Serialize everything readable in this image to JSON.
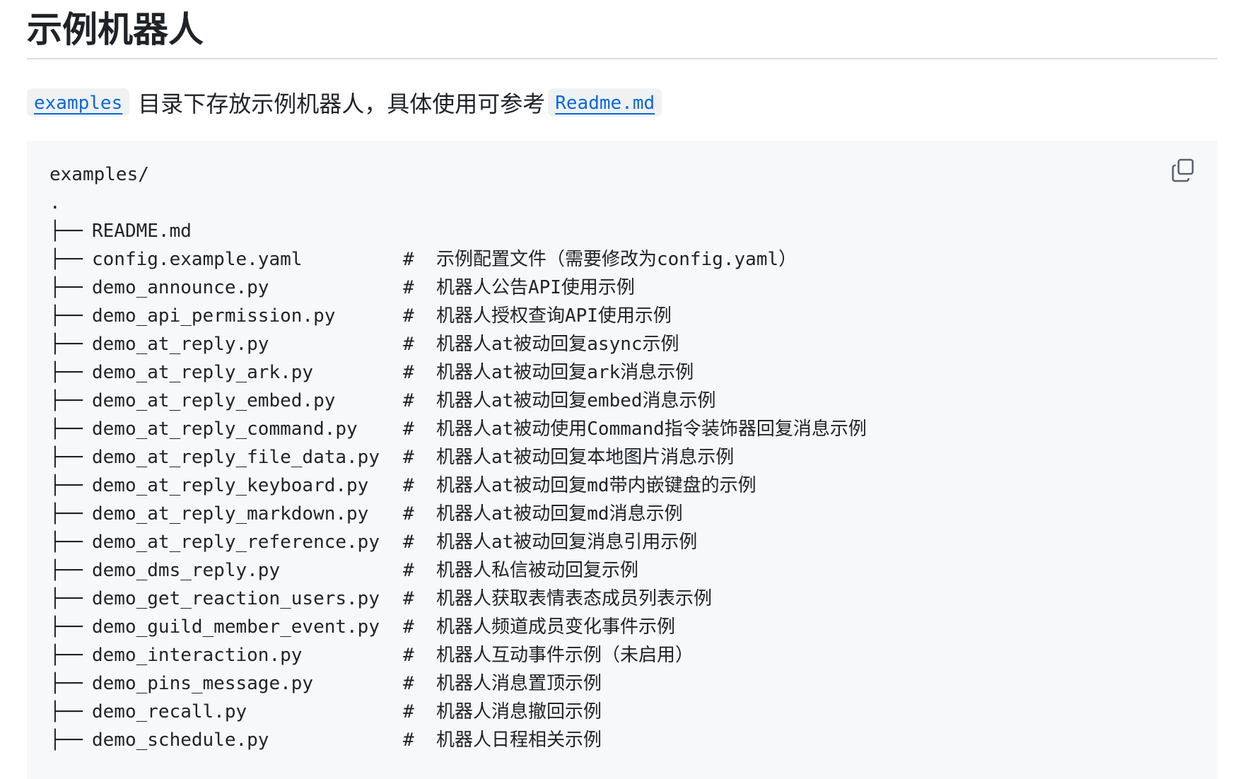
{
  "heading": "示例机器人",
  "intro": {
    "link1": "examples",
    "text": "目录下存放示例机器人，具体使用可参考",
    "link2": "Readme.md"
  },
  "code": {
    "root": "examples/",
    "dot": ".",
    "branch": "├──",
    "rows": [
      {
        "name": "README.md",
        "comment": ""
      },
      {
        "name": "config.example.yaml",
        "comment": "#  示例配置文件（需要修改为config.yaml）"
      },
      {
        "name": "demo_announce.py",
        "comment": "#  机器人公告API使用示例"
      },
      {
        "name": "demo_api_permission.py",
        "comment": "#  机器人授权查询API使用示例"
      },
      {
        "name": "demo_at_reply.py",
        "comment": "#  机器人at被动回复async示例"
      },
      {
        "name": "demo_at_reply_ark.py",
        "comment": "#  机器人at被动回复ark消息示例"
      },
      {
        "name": "demo_at_reply_embed.py",
        "comment": "#  机器人at被动回复embed消息示例"
      },
      {
        "name": "demo_at_reply_command.py",
        "comment": "#  机器人at被动使用Command指令装饰器回复消息示例"
      },
      {
        "name": "demo_at_reply_file_data.py",
        "comment": "#  机器人at被动回复本地图片消息示例"
      },
      {
        "name": "demo_at_reply_keyboard.py",
        "comment": "#  机器人at被动回复md带内嵌键盘的示例"
      },
      {
        "name": "demo_at_reply_markdown.py",
        "comment": "#  机器人at被动回复md消息示例"
      },
      {
        "name": "demo_at_reply_reference.py",
        "comment": "#  机器人at被动回复消息引用示例"
      },
      {
        "name": "demo_dms_reply.py",
        "comment": "#  机器人私信被动回复示例"
      },
      {
        "name": "demo_get_reaction_users.py",
        "comment": "#  机器人获取表情表态成员列表示例"
      },
      {
        "name": "demo_guild_member_event.py",
        "comment": "#  机器人频道成员变化事件示例"
      },
      {
        "name": "demo_interaction.py",
        "comment": "#  机器人互动事件示例（未启用）"
      },
      {
        "name": "demo_pins_message.py",
        "comment": "#  机器人消息置顶示例"
      },
      {
        "name": "demo_recall.py",
        "comment": "#  机器人消息撤回示例"
      },
      {
        "name": "demo_schedule.py",
        "comment": "#  机器人日程相关示例"
      }
    ]
  },
  "icons": {
    "copy": "copy-icon"
  },
  "colors": {
    "link": "#0969da",
    "code_bg": "#f6f8fa",
    "inline_code_bg": "#eff1f3",
    "text": "#1f2328",
    "divider": "#d8dee4"
  }
}
